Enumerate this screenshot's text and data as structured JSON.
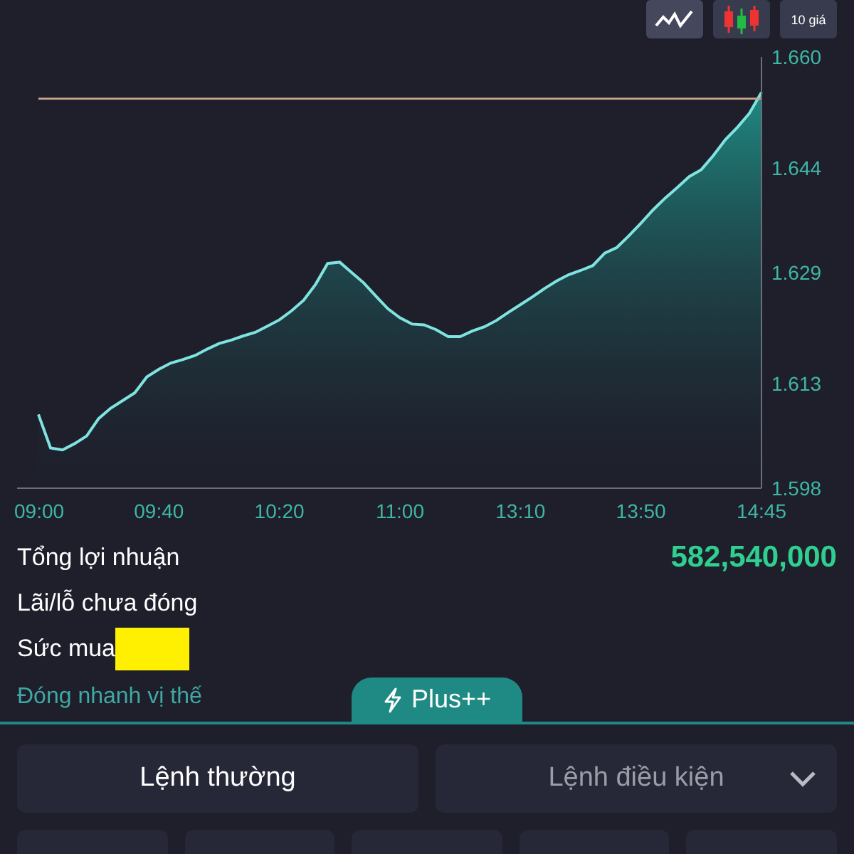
{
  "chart_controls": [
    {
      "kind": "line",
      "selected": true
    },
    {
      "kind": "candles",
      "selected": false
    },
    {
      "kind": "text",
      "label": "10 giá",
      "selected": false
    }
  ],
  "chart": {
    "chart_data": {
      "type": "area",
      "ylim": [
        1.598,
        1.66
      ],
      "categories": [
        "09:00",
        null,
        null,
        null,
        null,
        null,
        null,
        null,
        null,
        null,
        "09:40",
        null,
        null,
        null,
        null,
        null,
        null,
        null,
        null,
        null,
        "10:20",
        null,
        null,
        null,
        null,
        null,
        null,
        null,
        null,
        null,
        "11:00",
        null,
        null,
        null,
        null,
        null,
        null,
        null,
        null,
        null,
        "13:10",
        null,
        null,
        null,
        null,
        null,
        null,
        null,
        null,
        null,
        "13:50",
        null,
        null,
        null,
        null,
        null,
        null,
        null,
        null,
        null,
        "14:45"
      ],
      "yticks": [
        {
          "value": 1.598,
          "label": "1.598"
        },
        {
          "value": 1.613,
          "label": "1.613"
        },
        {
          "value": 1.629,
          "label": "1.629"
        },
        {
          "value": 1.644,
          "label": "1.644"
        },
        {
          "value": 1.66,
          "label": "1.660"
        }
      ],
      "series": [
        {
          "color": "#7fe3e0",
          "values": [
            1.6086,
            1.6038,
            1.6035,
            1.6044,
            1.6055,
            1.608,
            1.6095,
            1.6106,
            1.6117,
            1.614,
            1.6151,
            1.616,
            1.6165,
            1.6171,
            1.618,
            1.6188,
            1.6193,
            1.6199,
            1.6204,
            1.6213,
            1.6222,
            1.6235,
            1.625,
            1.6273,
            1.6303,
            1.6305,
            1.629,
            1.6275,
            1.6256,
            1.6238,
            1.6225,
            1.6216,
            1.6215,
            1.6208,
            1.6198,
            1.6198,
            1.6206,
            1.6212,
            1.6221,
            1.6233,
            1.6244,
            1.6255,
            1.6267,
            1.6278,
            1.6287,
            1.6293,
            1.63,
            1.6318,
            1.6326,
            1.6343,
            1.6361,
            1.638,
            1.6397,
            1.6412,
            1.6428,
            1.6438,
            1.6458,
            1.6481,
            1.6499,
            1.6519,
            1.6549
          ]
        }
      ],
      "ref_lines": [
        {
          "axis": "y",
          "value": 1.654
        }
      ]
    }
  },
  "summary": [
    {
      "label": "Tổng lợi nhuận",
      "value": "582,540,000"
    },
    {
      "label": "Lãi/lỗ chưa đóng"
    },
    {
      "label": "Sức mua",
      "redacted": true
    }
  ],
  "quick_close_link": "Đóng nhanh vị thế",
  "plus_tab": "Plus++",
  "order_tabs": [
    {
      "label": "Lệnh thường",
      "selected": true,
      "dropdown": false
    },
    {
      "label": "Lệnh điều kiện",
      "selected": false,
      "dropdown": true
    }
  ]
}
